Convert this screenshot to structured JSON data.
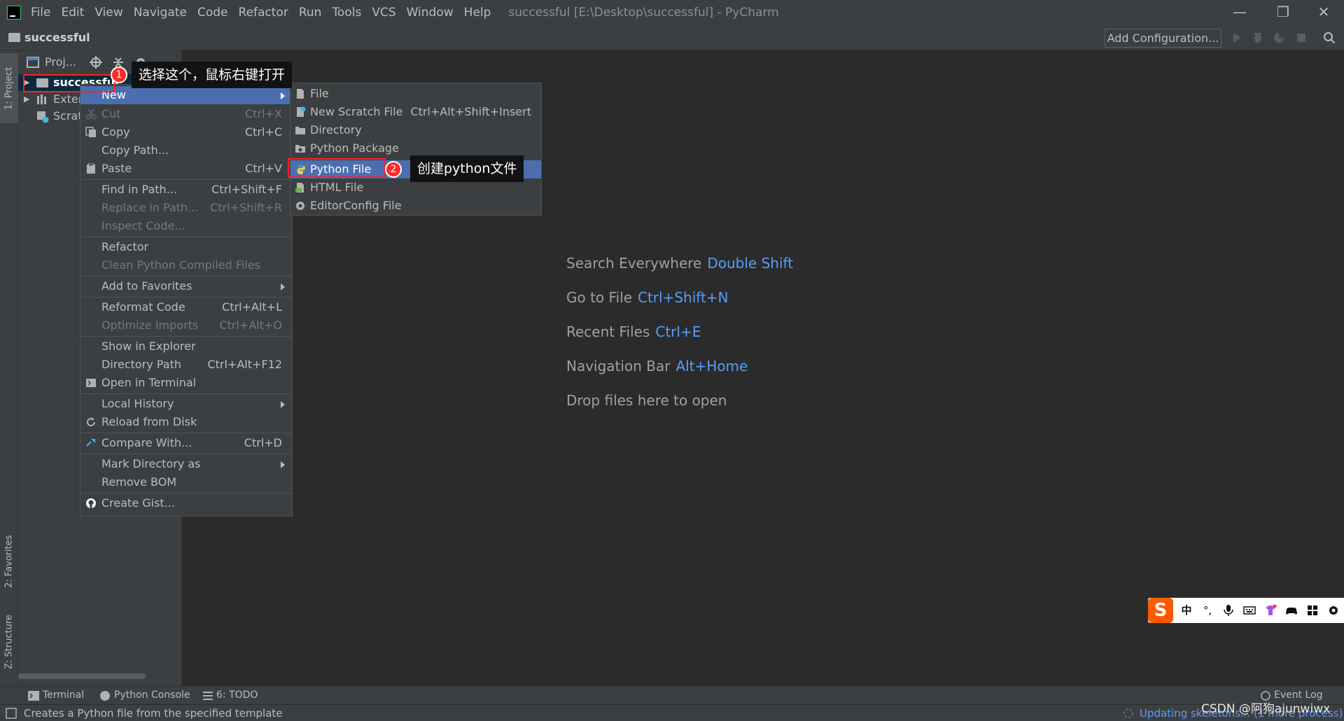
{
  "titlebar": {
    "menu": [
      "File",
      "Edit",
      "View",
      "Navigate",
      "Code",
      "Refactor",
      "Run",
      "Tools",
      "VCS",
      "Window",
      "Help"
    ],
    "window_title": "successful [E:\\Desktop\\successful] - PyCharm",
    "minimize": "—",
    "restore": "❐",
    "close": "✕"
  },
  "navbar": {
    "project_name": "successful",
    "add_configuration": "Add Configuration..."
  },
  "left_strip": {
    "project_tab": "1: Project",
    "favorites_tab": "2: Favorites",
    "structure_tab": "Z: Structure"
  },
  "project_panel": {
    "header_label": "Proj...",
    "tree": [
      {
        "label": "successful",
        "icon": "folder-icon"
      },
      {
        "label": "Exter",
        "icon": "library-icon"
      },
      {
        "label": "Scrat",
        "icon": "scratch-icon"
      }
    ]
  },
  "context_menu": {
    "items": [
      {
        "label": "New",
        "shortcut": "",
        "submenu": true,
        "selected": true,
        "disabled": false,
        "icon": ""
      },
      {
        "label": "Cut",
        "shortcut": "Ctrl+X",
        "disabled": true,
        "icon": "cut-icon"
      },
      {
        "label": "Copy",
        "shortcut": "Ctrl+C",
        "disabled": false,
        "icon": "copy-icon"
      },
      {
        "label": "Copy Path...",
        "shortcut": "",
        "disabled": false,
        "icon": ""
      },
      {
        "label": "Paste",
        "shortcut": "Ctrl+V",
        "disabled": false,
        "icon": "paste-icon"
      },
      {
        "label": "Find in Path...",
        "shortcut": "Ctrl+Shift+F",
        "disabled": false,
        "icon": ""
      },
      {
        "label": "Replace in Path...",
        "shortcut": "Ctrl+Shift+R",
        "disabled": true,
        "icon": ""
      },
      {
        "label": "Inspect Code...",
        "shortcut": "",
        "disabled": true,
        "icon": ""
      },
      {
        "label": "Refactor",
        "shortcut": "",
        "disabled": false,
        "icon": ""
      },
      {
        "label": "Clean Python Compiled Files",
        "shortcut": "",
        "disabled": true,
        "icon": ""
      },
      {
        "label": "Add to Favorites",
        "shortcut": "",
        "submenu": true,
        "disabled": false,
        "icon": ""
      },
      {
        "label": "Reformat Code",
        "shortcut": "Ctrl+Alt+L",
        "disabled": false,
        "icon": ""
      },
      {
        "label": "Optimize Imports",
        "shortcut": "Ctrl+Alt+O",
        "disabled": true,
        "icon": ""
      },
      {
        "label": "Show in Explorer",
        "shortcut": "",
        "disabled": false,
        "icon": ""
      },
      {
        "label": "Directory Path",
        "shortcut": "Ctrl+Alt+F12",
        "disabled": false,
        "icon": ""
      },
      {
        "label": "Open in Terminal",
        "shortcut": "",
        "disabled": false,
        "icon": "terminal-icon"
      },
      {
        "label": "Local History",
        "shortcut": "",
        "submenu": true,
        "disabled": false,
        "icon": ""
      },
      {
        "label": "Reload from Disk",
        "shortcut": "",
        "disabled": false,
        "icon": "reload-icon"
      },
      {
        "label": "Compare With...",
        "shortcut": "Ctrl+D",
        "disabled": false,
        "icon": "compare-icon"
      },
      {
        "label": "Mark Directory as",
        "shortcut": "",
        "submenu": true,
        "disabled": false,
        "icon": ""
      },
      {
        "label": "Remove BOM",
        "shortcut": "",
        "disabled": false,
        "icon": ""
      },
      {
        "label": "Create Gist...",
        "shortcut": "",
        "disabled": false,
        "icon": "github-icon"
      }
    ]
  },
  "submenu": {
    "items": [
      {
        "label": "File",
        "shortcut": "",
        "icon": "file-icon"
      },
      {
        "label": "New Scratch File",
        "shortcut": "Ctrl+Alt+Shift+Insert",
        "icon": "scratch-file-icon"
      },
      {
        "label": "Directory",
        "shortcut": "",
        "icon": "folder-icon"
      },
      {
        "label": "Python Package",
        "shortcut": "",
        "icon": "package-icon"
      },
      {
        "label": "Python File",
        "shortcut": "",
        "icon": "python-icon",
        "selected": true
      },
      {
        "label": "HTML File",
        "shortcut": "",
        "icon": "html-icon"
      },
      {
        "label": "EditorConfig File",
        "shortcut": "",
        "icon": "gear-icon"
      }
    ]
  },
  "editor_hints": [
    {
      "text": "Search Everywhere",
      "key": "Double Shift"
    },
    {
      "text": "Go to File",
      "key": "Ctrl+Shift+N"
    },
    {
      "text": "Recent Files",
      "key": "Ctrl+E"
    },
    {
      "text": "Navigation Bar",
      "key": "Alt+Home"
    },
    {
      "text": "Drop files here to open",
      "key": ""
    }
  ],
  "bottom_tabs": {
    "terminal": "Terminal",
    "python_console": "Python Console",
    "todo": "6: TODO",
    "event_log": "Event Log"
  },
  "status": {
    "text": "Creates a Python file from the specified template",
    "right": "Updating skeletons... (1 more process)"
  },
  "annotations": {
    "step1_number": "1",
    "step1_text": "选择这个，鼠标右键打开",
    "step2_number": "2",
    "step2_text": "创建python文件"
  },
  "ime": {
    "logo": "S",
    "lang": "中",
    "punct": "°,"
  },
  "watermark": "CSDN @阿狗ajunwiwx",
  "colors": {
    "accent": "#4b6eaf",
    "link": "#589df6",
    "annotation_red": "#ff2020"
  }
}
